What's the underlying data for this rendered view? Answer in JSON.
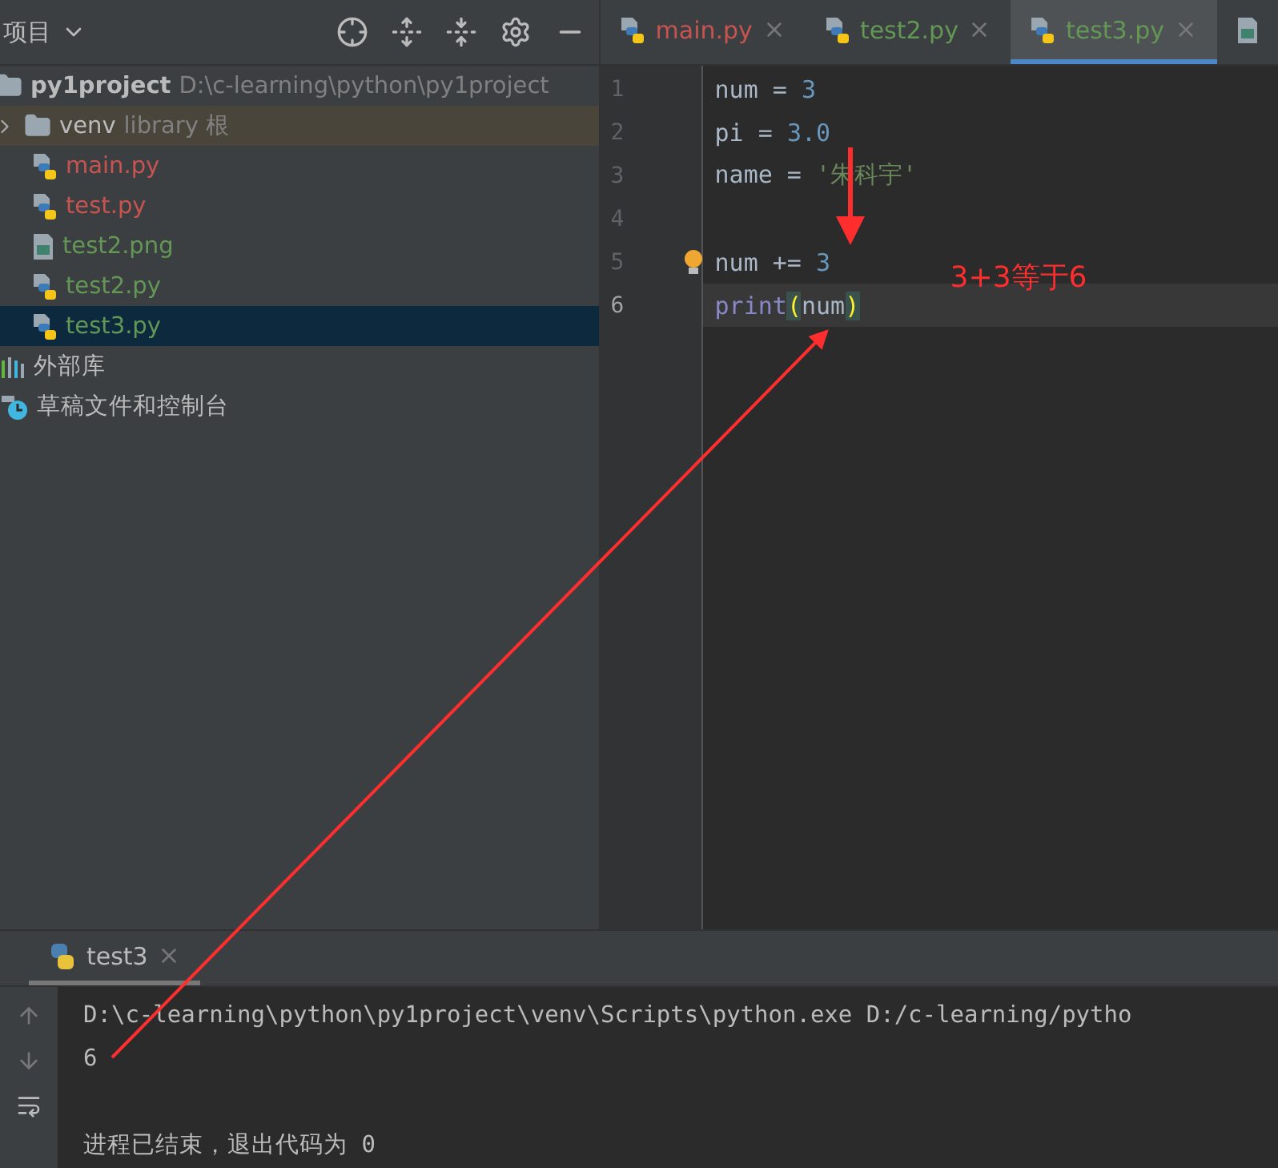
{
  "project_panel": {
    "title": "项目",
    "root": {
      "name": "py1project",
      "path": "D:\\c-learning\\python\\py1project",
      "children": [
        {
          "kind": "folder",
          "name": "venv",
          "hint": "library 根",
          "expanded": false,
          "selected": false
        },
        {
          "kind": "python",
          "name": "main.py",
          "color": "#c75450",
          "selected": false
        },
        {
          "kind": "python",
          "name": "test.py",
          "color": "#c75450",
          "selected": false
        },
        {
          "kind": "image",
          "name": "test2.png",
          "color": "#629755",
          "selected": false
        },
        {
          "kind": "python",
          "name": "test2.py",
          "color": "#629755",
          "selected": false
        },
        {
          "kind": "python",
          "name": "test3.py",
          "color": "#629755",
          "selected": true
        }
      ]
    },
    "extra": [
      {
        "kind": "library",
        "name": "外部库"
      },
      {
        "kind": "scratch",
        "name": "草稿文件和控制台"
      }
    ]
  },
  "editor_tabs": [
    {
      "kind": "python",
      "label": "main.py",
      "color": "#c75450",
      "selected": false
    },
    {
      "kind": "python",
      "label": "test2.py",
      "color": "#629755",
      "selected": false
    },
    {
      "kind": "python",
      "label": "test3.py",
      "color": "#629755",
      "selected": true
    },
    {
      "kind": "image",
      "selected": false
    }
  ],
  "code": [
    {
      "number": "1",
      "tokens": [
        {
          "kind": "plain",
          "text": "num = "
        },
        {
          "kind": "number",
          "text": "3"
        }
      ]
    },
    {
      "number": "2",
      "tokens": [
        {
          "kind": "plain",
          "text": "pi = "
        },
        {
          "kind": "number",
          "text": "3.0"
        }
      ]
    },
    {
      "number": "3",
      "tokens": [
        {
          "kind": "plain",
          "text": "name = "
        },
        {
          "kind": "string",
          "text": "'朱科宇'"
        }
      ]
    },
    {
      "number": "4"
    },
    {
      "number": "5",
      "bulb": true,
      "tokens": [
        {
          "kind": "plain",
          "text": "num += "
        },
        {
          "kind": "number",
          "text": "3"
        }
      ]
    },
    {
      "number": "6",
      "current": true,
      "tokens": [
        {
          "kind": "builtin",
          "text": "print"
        },
        {
          "kind": "brace",
          "text": "("
        },
        {
          "kind": "plain",
          "text": "num"
        },
        {
          "kind": "brace",
          "text": ")"
        }
      ]
    }
  ],
  "annotation": "3+3等于6",
  "run_panel": {
    "tab": "test3",
    "console": [
      {
        "kind": "output",
        "text": "D:\\c-learning\\python\\py1project\\venv\\Scripts\\python.exe D:/c-learning/pytho"
      },
      {
        "kind": "output",
        "text": "6"
      },
      {
        "kind": "blank"
      },
      {
        "kind": "output",
        "text": "进程已结束，退出代码为 0"
      }
    ]
  }
}
